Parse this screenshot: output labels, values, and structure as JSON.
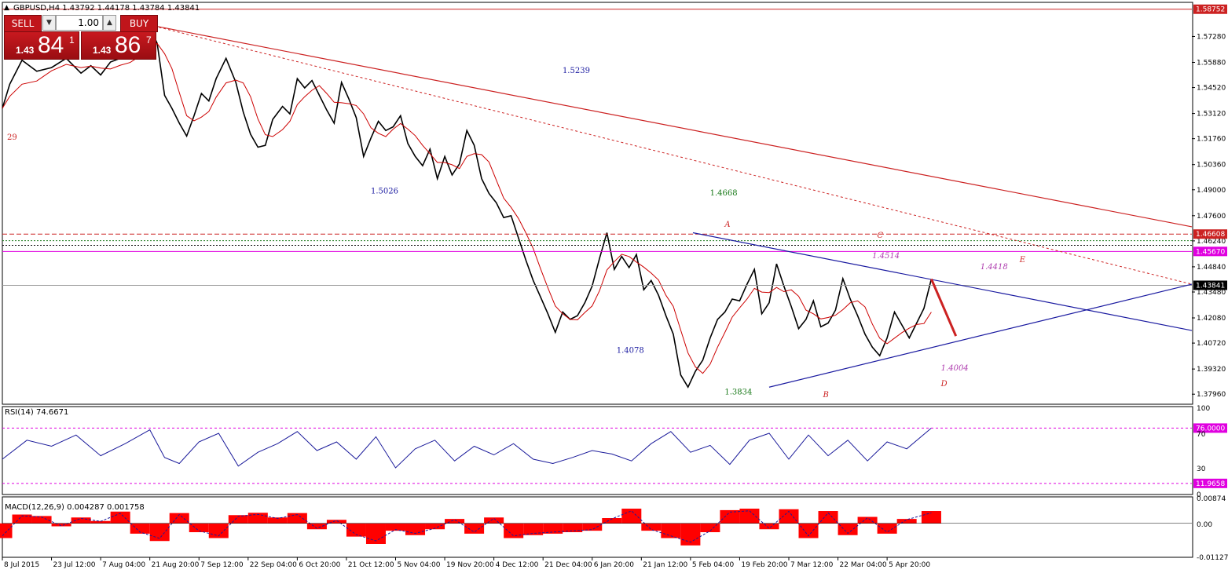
{
  "header": {
    "symbol_info": "GBPUSD,H4  1.43792 1.44178 1.43784 1.43841",
    "triangle_glyph": "triangle-up-icon"
  },
  "trade_panel": {
    "sell_label": "SELL",
    "buy_label": "BUY",
    "lots": "1.00",
    "sell_small": "1.43",
    "sell_big": "84",
    "sell_sup": "1",
    "buy_small": "1.43",
    "buy_big": "86",
    "buy_sup": "7"
  },
  "colors": {
    "background": "#ffffff",
    "candles": "#000000",
    "moving_average": "#cc0000",
    "blue_trendline": "#1a1aa0",
    "red_trendline": "#cc2222",
    "magenta_level": "#e000e0",
    "rsi_line": "#1a1a9a",
    "macd_histogram": "#ff0000",
    "price_tag_red": "#cc2222",
    "price_tag_black": "#000000",
    "price_tag_magenta": "#e000e0",
    "price_tag_green": "#1a7a1a"
  },
  "chart_data": [
    {
      "type": "line",
      "name": "price",
      "title": "GBPUSD,H4",
      "ylim": [
        1.3746,
        1.5908
      ],
      "y_ticks": [
        "1.57280",
        "1.55880",
        "1.54520",
        "1.53120",
        "1.51760",
        "1.50360",
        "1.49000",
        "1.47600",
        "1.46240",
        "1.44840",
        "1.43480",
        "1.42080",
        "1.40720",
        "1.39320",
        "1.37960"
      ],
      "x_ticks": [
        "8 Jul 2015",
        "23 Jul 12:00",
        "7 Aug 04:00",
        "21 Aug 20:00",
        "7 Sep 12:00",
        "22 Sep 04:00",
        "6 Oct 20:00",
        "21 Oct 12:00",
        "5 Nov 04:00",
        "19 Nov 20:00",
        "4 Dec 12:00",
        "21 Dec 04:00",
        "6 Jan 20:00",
        "21 Jan 12:00",
        "5 Feb 04:00",
        "19 Feb 20:00",
        "7 Mar 12:00",
        "22 Mar 04:00",
        "5 Apr 20:00"
      ],
      "x_tick_positions": [
        0.0,
        1.0,
        2.0,
        3.0,
        4.0,
        5.0,
        6.0,
        7.0,
        8.0,
        9.0,
        10.0,
        11.0,
        12.0,
        13.0,
        14.0,
        15.0,
        16.0,
        17.0,
        18.0
      ],
      "x_range": [
        0.0,
        24.2
      ],
      "series": [
        {
          "name": "GBPUSD",
          "x": [
            0.0,
            0.15,
            0.4,
            0.7,
            1.0,
            1.3,
            1.6,
            1.8,
            2.0,
            2.2,
            2.4,
            2.6,
            2.8,
            3.0,
            3.15,
            3.3,
            3.45,
            3.6,
            3.75,
            3.9,
            4.05,
            4.2,
            4.35,
            4.55,
            4.75,
            4.9,
            5.05,
            5.2,
            5.35,
            5.5,
            5.7,
            5.85,
            6.0,
            6.15,
            6.3,
            6.45,
            6.6,
            6.75,
            6.9,
            7.05,
            7.2,
            7.35,
            7.5,
            7.65,
            7.8,
            7.95,
            8.1,
            8.25,
            8.4,
            8.55,
            8.7,
            8.85,
            9.0,
            9.15,
            9.3,
            9.45,
            9.6,
            9.75,
            9.9,
            10.05,
            10.2,
            10.35,
            10.5,
            10.65,
            10.8,
            10.95,
            11.1,
            11.25,
            11.4,
            11.55,
            11.7,
            11.85,
            12.0,
            12.15,
            12.3,
            12.45,
            12.6,
            12.75,
            12.9,
            13.05,
            13.2,
            13.35,
            13.5,
            13.65,
            13.8,
            13.95,
            14.1,
            14.25,
            14.4,
            14.55,
            14.7,
            14.85,
            15.0,
            15.15,
            15.3,
            15.45,
            15.6,
            15.75,
            15.9,
            16.05,
            16.2,
            16.35,
            16.5,
            16.65,
            16.8,
            16.95,
            17.1,
            17.25,
            17.4,
            17.55,
            17.7,
            17.85,
            18.0,
            18.15,
            18.3,
            18.45,
            18.6,
            18.75,
            18.9
          ],
          "values": [
            1.534,
            1.547,
            1.56,
            1.554,
            1.556,
            1.561,
            1.553,
            1.557,
            1.552,
            1.559,
            1.561,
            1.563,
            1.566,
            1.578,
            1.569,
            1.541,
            1.534,
            1.526,
            1.519,
            1.53,
            1.542,
            1.538,
            1.55,
            1.561,
            1.548,
            1.532,
            1.52,
            1.513,
            1.514,
            1.528,
            1.535,
            1.531,
            1.55,
            1.545,
            1.549,
            1.541,
            1.533,
            1.526,
            1.548,
            1.539,
            1.529,
            1.508,
            1.518,
            1.527,
            1.522,
            1.524,
            1.53,
            1.515,
            1.508,
            1.503,
            1.512,
            1.496,
            1.508,
            1.498,
            1.504,
            1.522,
            1.514,
            1.496,
            1.488,
            1.483,
            1.475,
            1.476,
            1.464,
            1.452,
            1.441,
            1.432,
            1.423,
            1.413,
            1.424,
            1.42,
            1.422,
            1.429,
            1.438,
            1.453,
            1.4668,
            1.447,
            1.454,
            1.448,
            1.455,
            1.436,
            1.441,
            1.433,
            1.422,
            1.412,
            1.39,
            1.3834,
            1.392,
            1.398,
            1.41,
            1.42,
            1.424,
            1.431,
            1.43,
            1.439,
            1.447,
            1.423,
            1.429,
            1.45,
            1.438,
            1.427,
            1.415,
            1.42,
            1.43,
            1.416,
            1.418,
            1.425,
            1.442,
            1.431,
            1.422,
            1.412,
            1.405,
            1.4004,
            1.41,
            1.424,
            1.417,
            1.41,
            1.418,
            1.426,
            1.4418
          ]
        }
      ],
      "annotations": [
        "1.5239",
        "1.5026",
        "1.4668",
        "1.4078",
        "1.3834",
        "1.4514",
        "1.4418",
        "1.4004",
        "A",
        "B",
        "C",
        "D",
        "E",
        "29"
      ],
      "price_tags": [
        "1.58752",
        "1.46608",
        "1.45670",
        "1.43841"
      ],
      "grid": false,
      "legend": "none"
    },
    {
      "type": "line",
      "name": "rsi",
      "title": "RSI(14) 74.6671",
      "ylim": [
        0,
        100
      ],
      "y_ticks": [
        "100",
        "70",
        "30",
        "0"
      ],
      "levels": [
        76.0,
        11.9658
      ],
      "level_tags": [
        "76.0000",
        "11.9658"
      ],
      "series": [
        {
          "name": "RSI(14)",
          "x": [
            0.0,
            0.5,
            1.0,
            1.5,
            2.0,
            2.5,
            3.0,
            3.3,
            3.6,
            4.0,
            4.4,
            4.8,
            5.2,
            5.6,
            6.0,
            6.4,
            6.8,
            7.2,
            7.6,
            8.0,
            8.4,
            8.8,
            9.2,
            9.6,
            10.0,
            10.4,
            10.8,
            11.2,
            11.6,
            12.0,
            12.4,
            12.8,
            13.2,
            13.6,
            14.0,
            14.4,
            14.8,
            15.2,
            15.6,
            16.0,
            16.4,
            16.8,
            17.2,
            17.6,
            18.0,
            18.4,
            18.9
          ],
          "values": [
            40,
            62,
            55,
            68,
            44,
            58,
            74,
            42,
            35,
            60,
            70,
            32,
            48,
            58,
            72,
            50,
            60,
            40,
            66,
            30,
            52,
            62,
            38,
            55,
            45,
            58,
            40,
            35,
            42,
            50,
            46,
            38,
            58,
            72,
            48,
            56,
            34,
            62,
            70,
            40,
            68,
            44,
            62,
            38,
            60,
            52,
            76
          ]
        }
      ]
    },
    {
      "type": "bar",
      "name": "macd",
      "title": "MACD(12,26,9) 0.004287 0.001758",
      "ylim": [
        -0.01127,
        0.00874
      ],
      "y_ticks": [
        "0.00874",
        "0.00",
        "-0.01127"
      ],
      "series": [
        {
          "name": "MACD",
          "x": [
            0.0,
            0.4,
            0.8,
            1.2,
            1.6,
            2.0,
            2.4,
            2.8,
            3.2,
            3.6,
            4.0,
            4.4,
            4.8,
            5.2,
            5.6,
            6.0,
            6.4,
            6.8,
            7.2,
            7.6,
            8.0,
            8.4,
            8.8,
            9.2,
            9.6,
            10.0,
            10.4,
            10.8,
            11.2,
            11.6,
            12.0,
            12.4,
            12.8,
            13.2,
            13.6,
            14.0,
            14.4,
            14.8,
            15.2,
            15.6,
            16.0,
            16.4,
            16.8,
            17.2,
            17.6,
            18.0,
            18.4,
            18.9
          ],
          "values": [
            -0.005,
            0.003,
            0.0025,
            -0.001,
            0.002,
            0.0008,
            0.004,
            -0.0035,
            -0.006,
            0.0035,
            -0.003,
            -0.005,
            0.0028,
            0.0036,
            0.002,
            0.0035,
            -0.002,
            0.0012,
            -0.0045,
            -0.007,
            -0.0025,
            -0.004,
            -0.002,
            0.0015,
            -0.0035,
            0.002,
            -0.005,
            -0.004,
            -0.0035,
            -0.003,
            -0.0025,
            0.0018,
            0.005,
            -0.0025,
            -0.005,
            -0.0075,
            -0.003,
            0.0045,
            0.005,
            -0.002,
            0.0048,
            -0.005,
            0.0042,
            -0.004,
            0.0022,
            -0.0035,
            0.0015,
            0.0042
          ]
        }
      ]
    }
  ]
}
